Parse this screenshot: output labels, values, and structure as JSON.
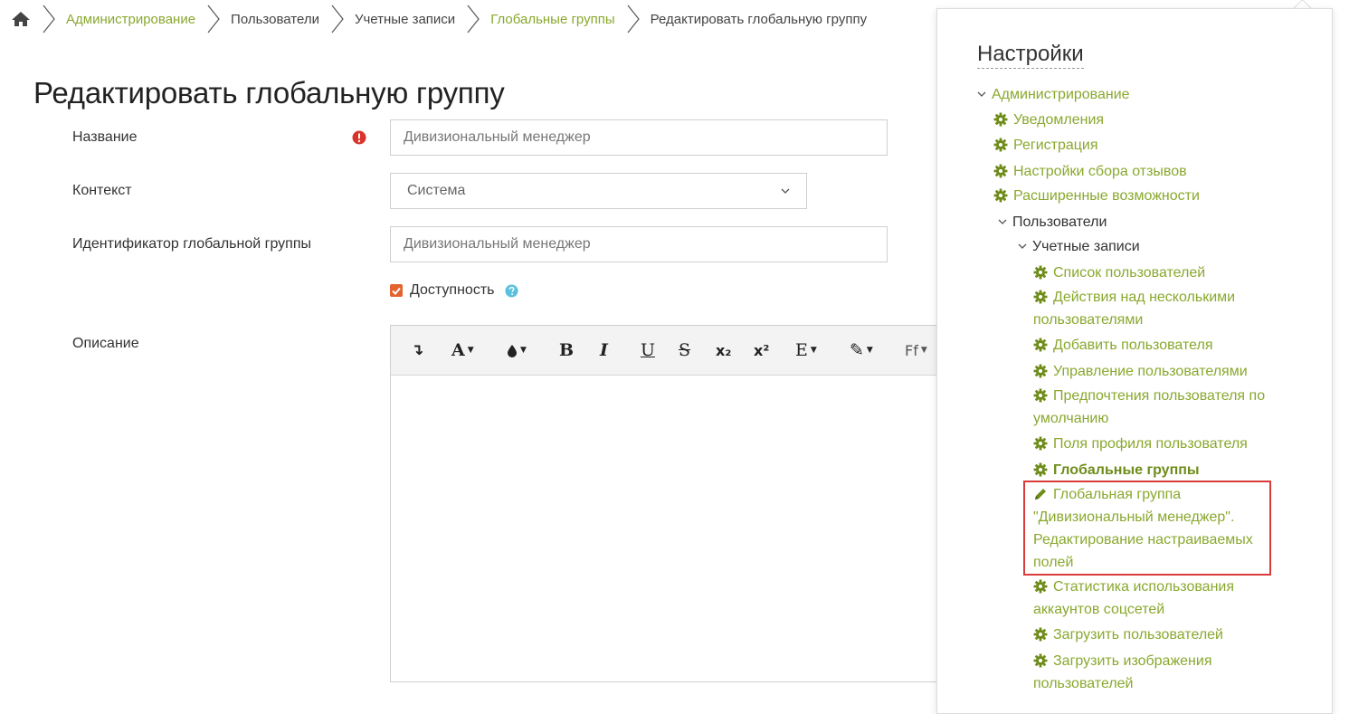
{
  "breadcrumb": {
    "items": [
      {
        "label": "Администрирование",
        "link": true
      },
      {
        "label": "Пользователи",
        "link": false
      },
      {
        "label": "Учетные записи",
        "link": false
      },
      {
        "label": "Глобальные группы",
        "link": true
      },
      {
        "label": "Редактировать глобальную группу",
        "link": false
      }
    ]
  },
  "page": {
    "title": "Редактировать глобальную группу"
  },
  "form": {
    "name_label": "Название",
    "name_value": "Дивизиональный менеджер",
    "context_label": "Контекст",
    "context_value": "Система",
    "idnumber_label": "Идентификатор глобальной группы",
    "idnumber_value": "Дивизиональный менеджер",
    "visible_label": "Доступность",
    "visible_checked": true,
    "description_label": "Описание"
  },
  "editor_toolbar": {
    "buttons": [
      {
        "name": "arrow-down-left-icon",
        "label": "↴"
      },
      {
        "name": "font-color-button",
        "label": "A"
      },
      {
        "name": "background-color-button",
        "label": "●"
      },
      {
        "name": "bold-button",
        "label": "B"
      },
      {
        "name": "italic-button",
        "label": "I"
      },
      {
        "name": "underline-button",
        "label": "U"
      },
      {
        "name": "strikethrough-button",
        "label": "S"
      },
      {
        "name": "subscript-button",
        "label": "x₂"
      },
      {
        "name": "superscript-button",
        "label": "x²"
      },
      {
        "name": "align-button",
        "label": "E"
      },
      {
        "name": "style-brush-button",
        "label": "✎"
      },
      {
        "name": "font-family-button",
        "label": "Ff"
      }
    ]
  },
  "settings": {
    "title": "Настройки",
    "admin": "Администрирование",
    "notifications": "Уведомления",
    "registration": "Регистрация",
    "feedback": "Настройки сбора отзывов",
    "advanced": "Расширенные возможности",
    "users": "Пользователи",
    "accounts": "Учетные записи",
    "user_list": "Список пользователей",
    "bulk_line1": "Действия над несколькими",
    "bulk_line2": "пользователями",
    "add_user": "Добавить пользователя",
    "manage_users": "Управление пользователями",
    "prefs_line1": "Предпочтения пользователя по",
    "prefs_line2": "умолчанию",
    "profile_fields": "Поля профиля пользователя",
    "cohorts": "Глобальные группы",
    "cohort_edit_line1": "Глобальная группа",
    "cohort_edit_line2": "\"Дивизиональный менеджер\".",
    "cohort_edit_line3": "Редактирование настраиваемых",
    "cohort_edit_line4": "полей",
    "social_line1": "Статистика использования",
    "social_line2": "аккаунтов соцсетей",
    "upload_users": "Загрузить пользователей",
    "upload_pics_line1": "Загрузить изображения",
    "upload_pics_line2": "пользователей"
  },
  "colors": {
    "accent": "#8aa82e",
    "checkbox": "#e3632e",
    "required": "#d9342b",
    "help": "#5bc0de",
    "highlight": "#d93a3a"
  }
}
